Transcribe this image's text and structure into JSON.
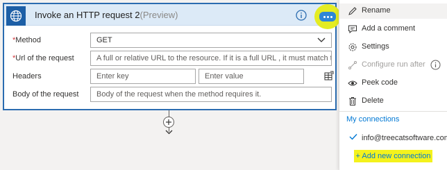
{
  "card": {
    "title": "Invoke an HTTP request 2",
    "title_suffix": "(Preview)",
    "fields": {
      "method": {
        "label": "Method",
        "required_mark": "*",
        "value": "GET"
      },
      "url": {
        "label": "Url of the request",
        "required_mark": "*",
        "placeholder": "A full or relative URL to the resource. If it is a full URL , it must match the"
      },
      "headers": {
        "label": "Headers",
        "key_placeholder": "Enter key",
        "value_placeholder": "Enter value"
      },
      "body": {
        "label": "Body of the request",
        "placeholder": "Body of the request when the method requires it."
      }
    }
  },
  "menu": {
    "items": [
      {
        "label": "Rename",
        "icon": "pencil-icon"
      },
      {
        "label": "Add a comment",
        "icon": "comment-icon"
      },
      {
        "label": "Settings",
        "icon": "gear-icon"
      },
      {
        "label": "Configure run after",
        "icon": "run-after-icon",
        "disabled": true
      },
      {
        "label": "Peek code",
        "icon": "eye-icon"
      },
      {
        "label": "Delete",
        "icon": "trash-icon"
      }
    ],
    "connections_heading": "My connections",
    "connection_email": "info@treecatsoftware.com",
    "add_connection": "+ Add new connection"
  },
  "colors": {
    "accent": "#0078d4",
    "header_bg": "#dceaf7",
    "highlight": "#f4f21c",
    "card_border": "#2b6cb0"
  }
}
